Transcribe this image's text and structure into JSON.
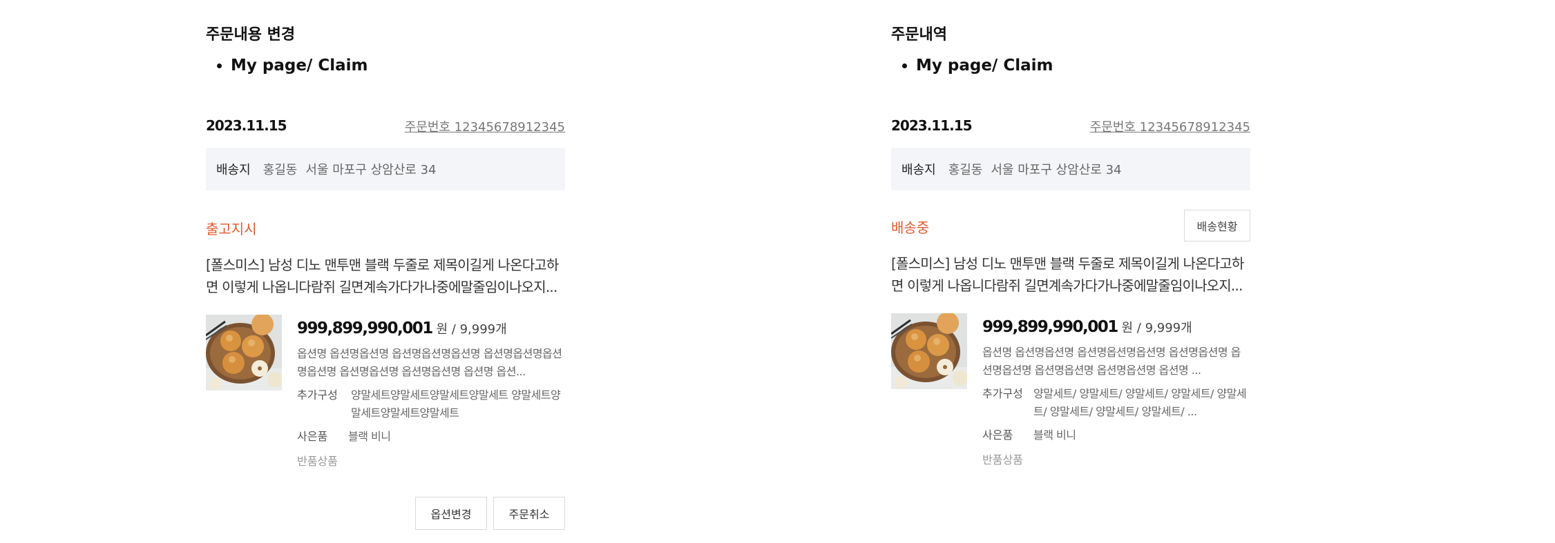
{
  "panels": [
    {
      "title": "주문내용 변경",
      "breadcrumb": "My page/ Claim",
      "order_date": "2023.11.15",
      "order_number": "주문번호 12345678912345",
      "shipping": {
        "label": "배송지",
        "name": "홍길동",
        "address": "서울 마포구 상암산로 34"
      },
      "status": "출고지시",
      "product_name": "[폴스미스] 남성 디노 맨투맨 블랙 두줄로 제목이길게 나온다고하면 이렇게 나옵니다람쥐 길면계속가다가나중에말줄임이나오지...",
      "price": "999,899,990,001",
      "price_unit": "원",
      "quantity": "/ 9,999개",
      "options": "옵션명 옵션명옵션명 옵션명옵션명옵션명 옵션명옵션명옵션명옵션명 옵션명옵션명 옵션명옵션명 옵션명 옵션...",
      "extra_label": "추가구성",
      "extra_value": "양말세트양말세트양말세트양말세트 양말세트양말세트양말세트양말세트",
      "gift_label": "사은품",
      "gift_value": "블랙 비니",
      "return_label": "반품상품",
      "buttons": {
        "change_option": "옵션변경",
        "cancel_order": "주문취소"
      }
    },
    {
      "title": "주문내역",
      "breadcrumb": "My page/ Claim",
      "order_date": "2023.11.15",
      "order_number": "주문번호 12345678912345",
      "shipping": {
        "label": "배송지",
        "name": "홍길동",
        "address": "서울 마포구 상암산로 34"
      },
      "status": "배송중",
      "tracking_button": "배송현황",
      "product_name": "[폴스미스] 남성 디노 맨투맨 블랙 두줄로 제목이길게 나온다고하면 이렇게 나옵니다람쥐 길면계속가다가나중에말줄임이나오지...",
      "price": "999,899,990,001",
      "price_unit": "원",
      "quantity": "/ 9,999개",
      "options": "옵션명 옵션명옵션명 옵션명옵션명옵션명 옵션명옵션명 옵션명옵션명 옵션명옵션명 옵션명옵션명 옵션명 ...",
      "extra_label": "추가구성",
      "extra_value": "양말세트/ 양말세트/ 양말세트/ 양말세트/ 양말세트/ 양말세트/ 양말세트/ 양말세트/ ...",
      "gift_label": "사은품",
      "gift_value": "블랙 비니",
      "return_label": "반품상품"
    }
  ],
  "colors": {
    "status_accent": "#e05a2f",
    "shipping_background": "#f4f5f8",
    "border": "#d9d9d9"
  },
  "icons": {
    "product_thumbnail": "asian-pear-plate-image"
  }
}
